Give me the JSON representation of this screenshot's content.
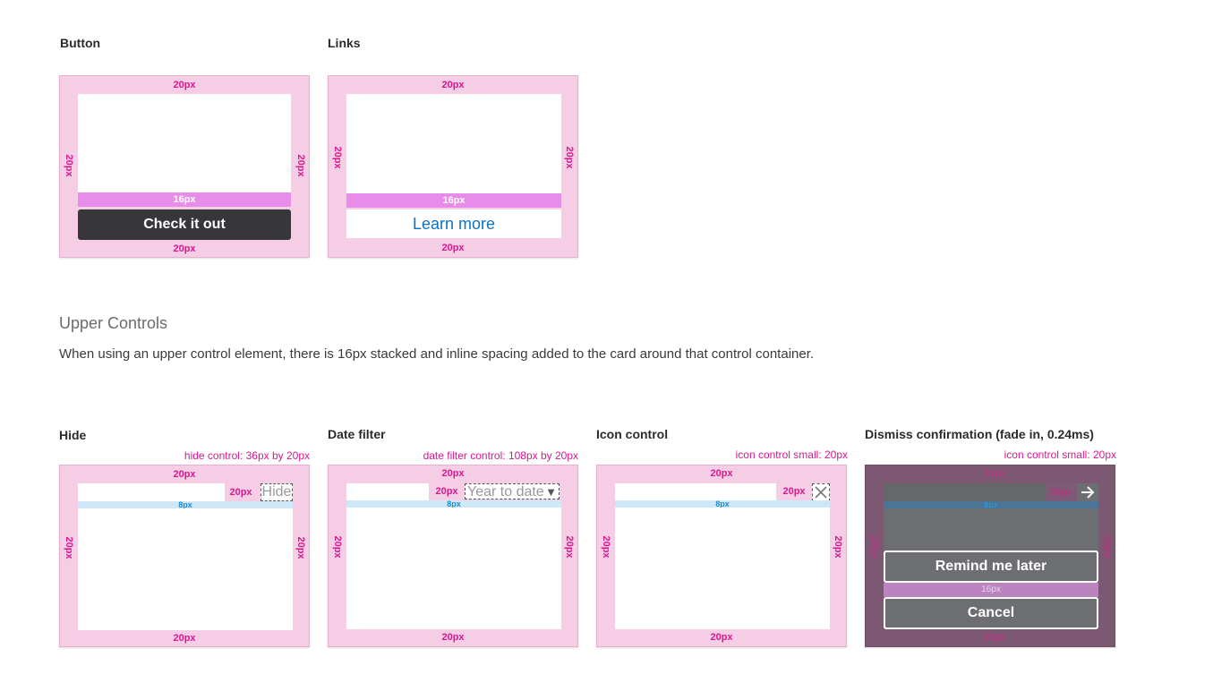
{
  "top_cards": {
    "button": {
      "heading": "Button",
      "padding_label": "20px",
      "gap_label": "16px",
      "button_label": "Check it out"
    },
    "links": {
      "heading": "Links",
      "padding_label": "20px",
      "gap_label": "16px",
      "link_label": "Learn more"
    }
  },
  "upper_controls": {
    "title": "Upper Controls",
    "description": "When using an upper control element, there is 16px stacked and inline spacing added to the card around that control container."
  },
  "bottom_cards": {
    "hide": {
      "heading": "Hide",
      "spec": "hide control: 36px by 20px",
      "padding_label": "20px",
      "gap_label": "8px",
      "control_gap_label": "20px",
      "control_label": "Hide"
    },
    "date_filter": {
      "heading": "Date filter",
      "spec": "date filter control: 108px by 20px",
      "padding_label": "20px",
      "gap_label": "8px",
      "control_gap_label": "20px",
      "control_label": "Year to date",
      "dropdown_icon": "▼"
    },
    "icon_control": {
      "heading": "Icon control",
      "spec": "icon control small: 20px",
      "padding_label": "20px",
      "gap_label": "8px",
      "control_gap_label": "20px",
      "icon": "close-icon"
    },
    "dismiss": {
      "heading": "Dismiss confirmation (fade in, 0.24ms)",
      "spec": "icon control small: 20px",
      "padding_label": "20px",
      "gap_label": "8px",
      "control_gap_label": "20px",
      "icon": "arrow-right-icon",
      "remind_label": "Remind me later",
      "gap16_label": "16px",
      "cancel_label": "Cancel"
    }
  },
  "colors": {
    "padding_pink": "#f5cde5",
    "spacing_magenta": "#e78ce9",
    "label_magenta": "#d6188f",
    "spacing_blue": "#cfe8f7",
    "button_dark": "#37373b",
    "link_blue": "#0c72c2",
    "dismiss_bg": "#7c5872",
    "dismiss_inner": "#6d6e71"
  }
}
